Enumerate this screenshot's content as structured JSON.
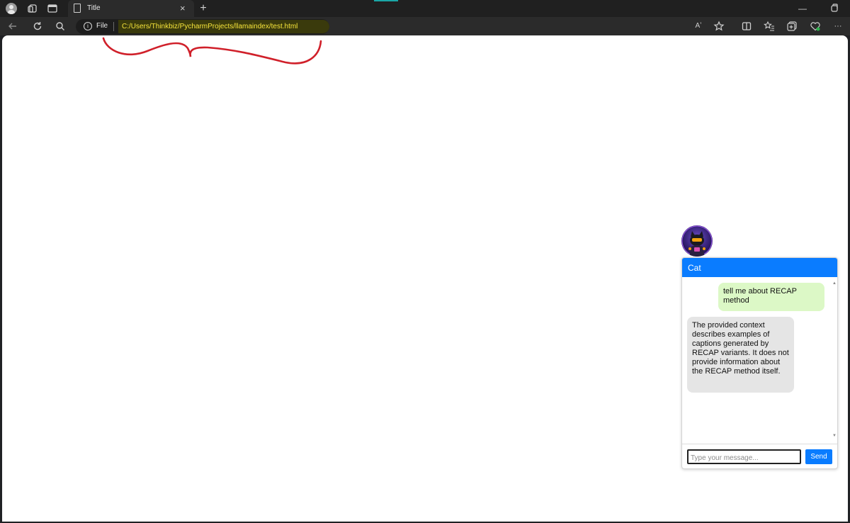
{
  "browser": {
    "tab_title": "Title",
    "tab_close": "×",
    "new_tab": "+",
    "address": {
      "scheme_label": "File",
      "url": "C:/Users/Thinkbiz/PycharmProjects/llamaindex/test.html"
    },
    "read_aloud_label": "Aʼ",
    "window_minimize": "—",
    "more_label": "···"
  },
  "chat": {
    "title": "Cat",
    "messages": [
      {
        "role": "user",
        "text": "tell me about RECAP method"
      },
      {
        "role": "bot",
        "text": "The provided context describes examples of captions generated by RECAP variants. It does not provide information about the RECAP method itself."
      }
    ],
    "input_placeholder": "Type your message...",
    "input_value": "",
    "send_label": "Send"
  },
  "colors": {
    "chat_header": "#0a7cff",
    "user_bubble": "#dcf8c6",
    "bot_bubble": "#e5e5e5",
    "url_highlight": "#f5e33a",
    "annotation_stroke": "#d0202a"
  },
  "icons": [
    "profile-icon",
    "workspaces-icon",
    "tab-actions-icon",
    "document-icon",
    "close-icon",
    "plus-icon",
    "back-icon",
    "refresh-icon",
    "search-icon",
    "info-icon",
    "read-aloud-icon",
    "favorite-star-icon",
    "split-screen-icon",
    "favorites-icon",
    "collections-icon",
    "browser-essentials-icon",
    "more-icon"
  ]
}
